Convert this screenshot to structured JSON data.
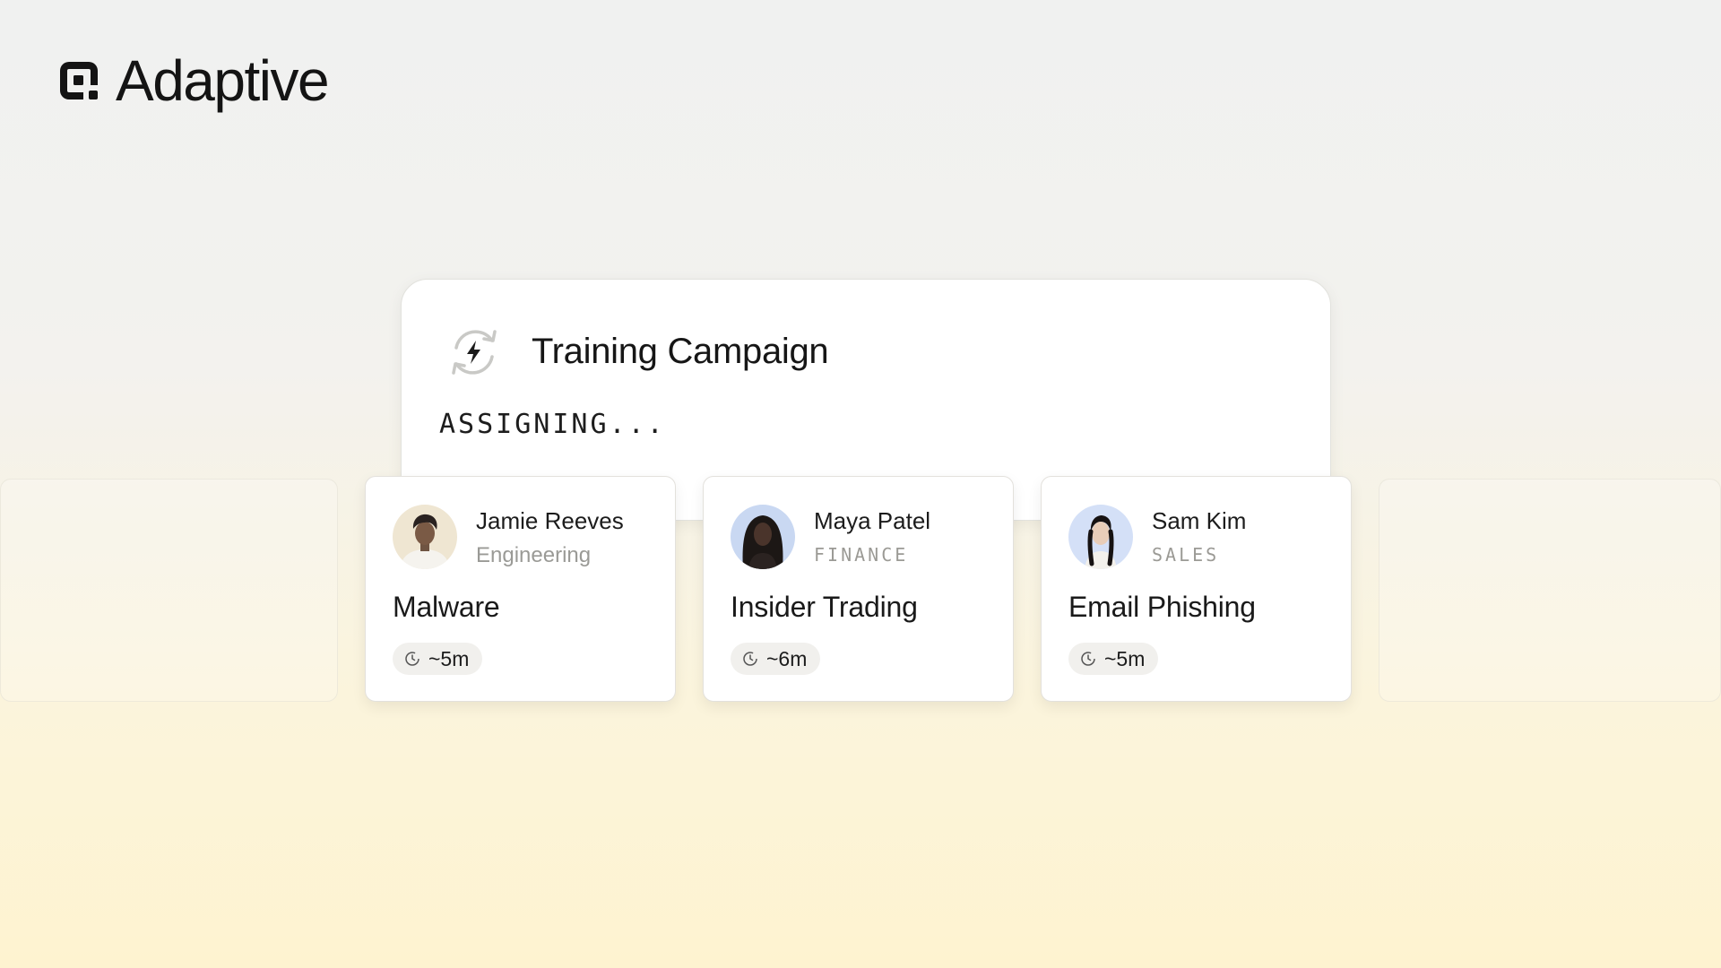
{
  "brand": {
    "name": "Adaptive"
  },
  "campaign": {
    "title": "Training Campaign",
    "status": "ASSIGNING...",
    "icon": "refresh-bolt-icon"
  },
  "users": [
    {
      "name": "Jamie Reeves",
      "department": "Engineering",
      "module": "Malware",
      "duration": "~5m"
    },
    {
      "name": "Maya Patel",
      "department": "FINANCE",
      "module": "Insider Trading",
      "duration": "~6m"
    },
    {
      "name": "Sam Kim",
      "department": "SALES",
      "module": "Email Phishing",
      "duration": "~5m"
    }
  ],
  "colors": {
    "text": "#1b1b1b",
    "muted": "#9a9a96",
    "pill": "#f1f0ed",
    "avatar_1_bg": "#efe6d2",
    "avatar_2_bg": "#c9d8f2",
    "avatar_3_bg": "#d4e0f7"
  }
}
